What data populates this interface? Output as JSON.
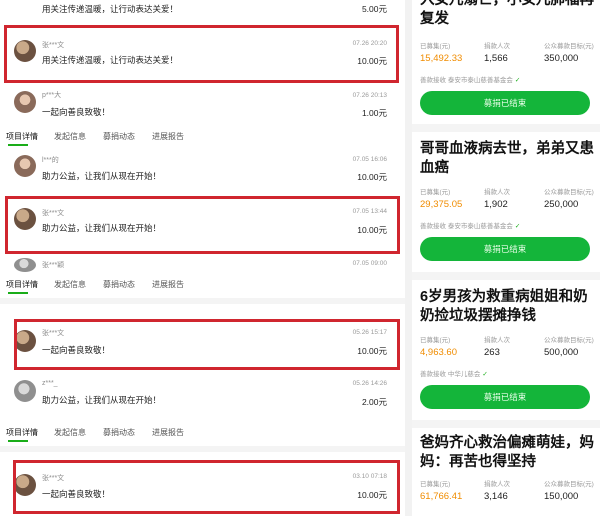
{
  "tabs": [
    "项目详情",
    "发起信息",
    "募捐动态",
    "进展报告"
  ],
  "left": {
    "records": [
      {
        "msg": "用关注传递温暖，让行动表达关爱！",
        "amount": "5.00元"
      },
      {
        "name": "张***文",
        "msg": "用关注传递温暖，让行动表达关爱！",
        "time": "07.26 20:20",
        "amount": "10.00元"
      },
      {
        "name": "p***大",
        "msg": "一起向善良致敬！",
        "time": "07.26 20:13",
        "amount": "1.00元"
      },
      {
        "name": "l***的",
        "msg": "助力公益，让我们从现在开始！",
        "time": "07.05 16:06",
        "amount": "10.00元"
      },
      {
        "name": "张***文",
        "msg": "助力公益，让我们从现在开始！",
        "time": "07.05 13:44",
        "amount": "10.00元"
      },
      {
        "name": "张***颖",
        "time": "07.05 09:00"
      },
      {
        "name": "张***文",
        "msg": "一起向善良致敬！",
        "time": "05.26 15:17",
        "amount": "10.00元"
      },
      {
        "name": "z***_",
        "msg": "助力公益，让我们从现在开始！",
        "time": "05.26 14:26",
        "amount": "2.00元"
      },
      {
        "name": "张***文",
        "msg": "一起向善良致敬！",
        "time": "03.10 07:18",
        "amount": "10.00元"
      }
    ]
  },
  "right": {
    "labels": {
      "raised": "已募集(元)",
      "donors": "捐款人次",
      "target": "公众募款目标(元)",
      "org": "善款接收",
      "button": "募捐已结束"
    },
    "cards": [
      {
        "title": "入女儿溺亡，小女儿肺福再复发",
        "raised": "15,492.33",
        "donors": "1,566",
        "target": "350,000",
        "org": "泰安市泰山慈善基金会"
      },
      {
        "title": "哥哥血液病去世，弟弟又患血癌",
        "raised": "29,375.05",
        "donors": "1,902",
        "target": "250,000",
        "org": "泰安市泰山慈善基金会"
      },
      {
        "title": "6岁男孩为救重病姐姐和奶奶捡垃圾摆摊挣钱",
        "raised": "4,963.60",
        "donors": "263",
        "target": "500,000",
        "org": "中华儿慈会"
      },
      {
        "title": "爸妈齐心救治偏瘫萌娃，妈妈：再苦也得坚持",
        "raised": "61,766.41",
        "donors": "3,146",
        "target": "150,000"
      }
    ]
  },
  "colors": {
    "highlight": "#d0262f",
    "accent": "#14b53a",
    "orange": "#f08c00"
  },
  "icons": [
    "avatar",
    "verified-check-icon"
  ]
}
